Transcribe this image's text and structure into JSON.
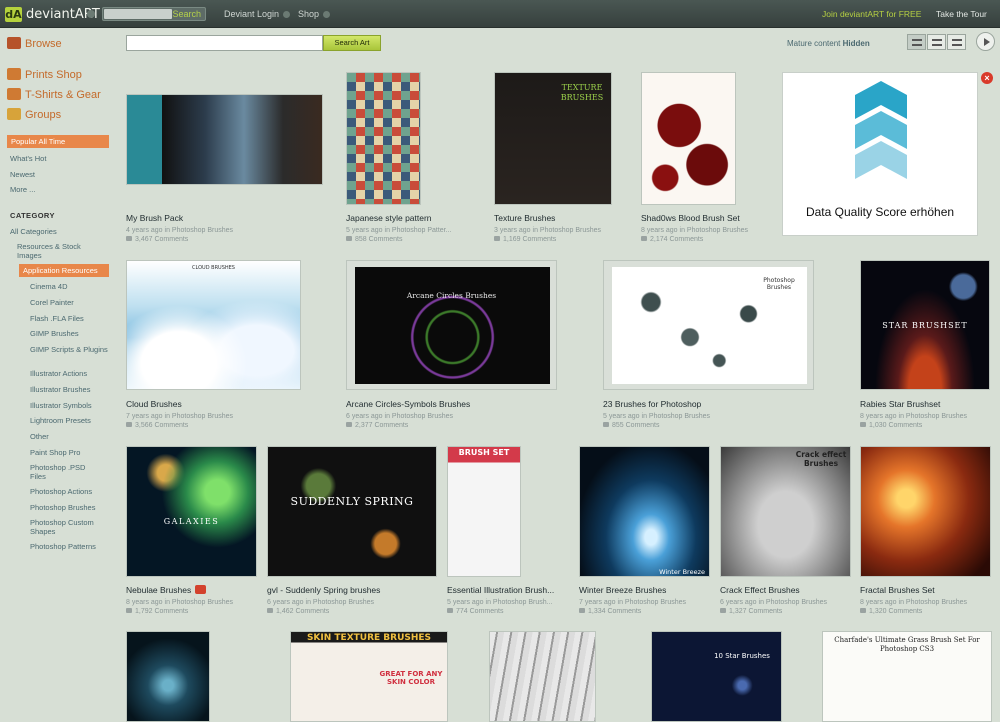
{
  "topbar": {
    "logo_text": "deviantART",
    "search_label": "Search",
    "login_label": "Deviant Login",
    "shop_label": "Shop",
    "join_label": "Join deviantART for FREE",
    "tour_label": "Take the Tour"
  },
  "sidebar": {
    "browse": "Browse",
    "prints": "Prints Shop",
    "tshirts": "T-Shirts & Gear",
    "groups": "Groups",
    "popular": "Popular All Time",
    "whats_hot": "What's Hot",
    "newest": "Newest",
    "more": "More ...",
    "category_title": "CATEGORY",
    "all_categories": "All Categories",
    "resources": "Resources & Stock Images",
    "app_resources": "Application Resources",
    "subcats": [
      "Cinema 4D",
      "Corel Painter",
      "Flash .FLA Files",
      "GIMP Brushes",
      "GIMP Scripts & Plugins",
      "Illustrator Actions",
      "Illustrator Brushes",
      "Illustrator Symbols",
      "Lightroom Presets",
      "Other",
      "Paint Shop Pro",
      "Photoshop .PSD Files",
      "Photoshop Actions",
      "Photoshop Brushes",
      "Photoshop Custom Shapes",
      "Photoshop Patterns"
    ]
  },
  "toolbar": {
    "search_value": "",
    "search_button": "Search Art",
    "mature_label": "Mature content",
    "mature_state": "Hidden"
  },
  "ad": {
    "text": "Data Quality Score erhöhen",
    "close": "×"
  },
  "items": [
    {
      "title": "My Brush Pack",
      "meta": "4 years ago in Photoshop Brushes",
      "comments": "3,467 Comments"
    },
    {
      "title": "Japanese style pattern",
      "meta": "5 years ago in Photoshop Patter...",
      "comments": "858 Comments"
    },
    {
      "title": "Texture Brushes",
      "meta": "3 years ago in Photoshop Brushes",
      "comments": "1,169 Comments"
    },
    {
      "title": "Shad0ws Blood Brush Set",
      "meta": "8 years ago in Photoshop Brushes",
      "comments": "2,174 Comments"
    },
    {
      "title": "Cloud Brushes",
      "meta": "7 years ago in Photoshop Brushes",
      "comments": "3,566 Comments"
    },
    {
      "title": "Arcane Circles-Symbols Brushes",
      "meta": "6 years ago in Photoshop Brushes",
      "comments": "2,377 Comments"
    },
    {
      "title": "23 Brushes for Photoshop",
      "meta": "5 years ago in Photoshop Brushes",
      "comments": "855 Comments"
    },
    {
      "title": "Rabies Star Brushset",
      "meta": "8 years ago in Photoshop Brushes",
      "comments": "1,030 Comments"
    },
    {
      "title": "Nebulae Brushes",
      "meta": "8 years ago in Photoshop Brushes",
      "comments": "1,792 Comments"
    },
    {
      "title": "gvl - Suddenly Spring brushes",
      "meta": "6 years ago in Photoshop Brushes",
      "comments": "1,462 Comments"
    },
    {
      "title": "Essential Illustration Brush...",
      "meta": "5 years ago in Photoshop Brush...",
      "comments": "774 Comments"
    },
    {
      "title": "Winter Breeze Brushes",
      "meta": "7 years ago in Photoshop Brushes",
      "comments": "1,334 Comments"
    },
    {
      "title": "Crack Effect Brushes",
      "meta": "6 years ago in Photoshop Brushes",
      "comments": "1,327 Comments"
    },
    {
      "title": "Fractal Brushes Set",
      "meta": "8 years ago in Photoshop Brushes",
      "comments": "1,320 Comments"
    }
  ],
  "thumb_captions": {
    "cloud": "CLOUD BRUSHES",
    "arcane": "Arcane Circles Brushes",
    "brushes23": "Photoshop Brushes",
    "star": "STAR BRUSHSET",
    "galaxies": "GALAXIES",
    "spring": "SUDDENLY SPRING",
    "brushset": "BRUSH SET",
    "winter": "Winter Breeze",
    "crack": "Crack effect Brushes",
    "texture": "TEXTURE BRUSHES",
    "skin": "SKIN TEXTURE BRUSHES",
    "skin_sub": "GREAT FOR ANY SKIN COLOR",
    "tenstar": "10 Star Brushes",
    "grass": "Charfade's Ultimate Grass Brush Set For Photoshop CS3"
  }
}
